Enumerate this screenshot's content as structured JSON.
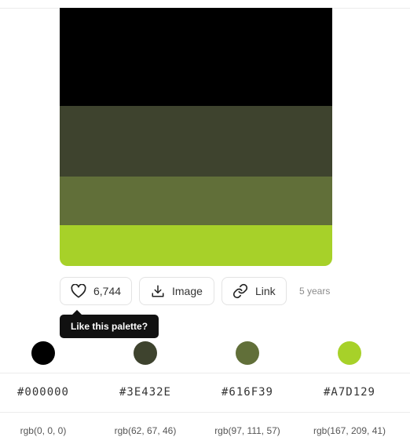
{
  "palette": {
    "colors": [
      "#000000",
      "#3E432E",
      "#616F39",
      "#A7D129"
    ]
  },
  "actions": {
    "likes": "6,744",
    "image_label": "Image",
    "link_label": "Link",
    "age": "5 years"
  },
  "tooltip": {
    "text": "Like this palette?"
  },
  "swatches": [
    {
      "hex": "#000000",
      "rgb": "rgb(0, 0, 0)"
    },
    {
      "hex": "#3E432E",
      "rgb": "rgb(62, 67, 46)"
    },
    {
      "hex": "#616F39",
      "rgb": "rgb(97, 111, 57)"
    },
    {
      "hex": "#A7D129",
      "rgb": "rgb(167, 209, 41)"
    }
  ],
  "icons": {
    "like": "heart-icon",
    "image": "download-icon",
    "link": "link-icon"
  }
}
